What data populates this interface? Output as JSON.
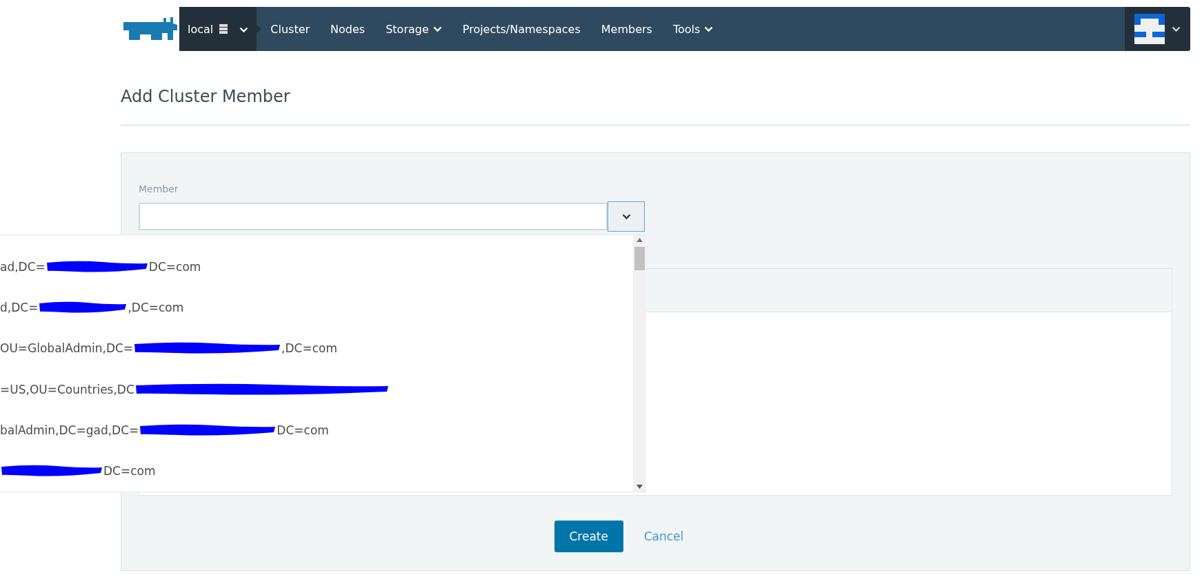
{
  "header": {
    "cluster_switcher": {
      "label": "local"
    },
    "nav": [
      {
        "label": "Cluster",
        "has_menu": false
      },
      {
        "label": "Nodes",
        "has_menu": false
      },
      {
        "label": "Storage",
        "has_menu": true
      },
      {
        "label": "Projects/Namespaces",
        "has_menu": false
      },
      {
        "label": "Members",
        "has_menu": false
      },
      {
        "label": "Tools",
        "has_menu": true
      }
    ]
  },
  "page_title": "Add Cluster Member",
  "form": {
    "member_label": "Member",
    "options": [
      {
        "segments": [
          {
            "kind": "text",
            "text": "ad,DC="
          },
          {
            "kind": "redacted"
          },
          {
            "kind": "text",
            "text": "DC=com"
          }
        ]
      },
      {
        "segments": [
          {
            "kind": "text",
            "text": "d,DC="
          },
          {
            "kind": "redacted"
          },
          {
            "kind": "text",
            "text": ",DC=com"
          }
        ]
      },
      {
        "segments": [
          {
            "kind": "text",
            "text": "OU=GlobalAdmin,DC="
          },
          {
            "kind": "redacted"
          },
          {
            "kind": "text",
            "text": ",DC=com"
          }
        ]
      },
      {
        "segments": [
          {
            "kind": "text",
            "text": "=US,OU=Countries,DC"
          },
          {
            "kind": "redacted"
          }
        ]
      },
      {
        "segments": [
          {
            "kind": "text",
            "text": "balAdmin,DC=gad,DC="
          },
          {
            "kind": "redacted"
          },
          {
            "kind": "text",
            "text": "DC=com"
          }
        ]
      },
      {
        "segments": [
          {
            "kind": "redacted"
          },
          {
            "kind": "text",
            "text": "DC=com"
          }
        ]
      }
    ],
    "buttons": [
      {
        "kind": "primary",
        "label": "Create"
      },
      {
        "kind": "link",
        "label": "Cancel"
      }
    ]
  }
}
